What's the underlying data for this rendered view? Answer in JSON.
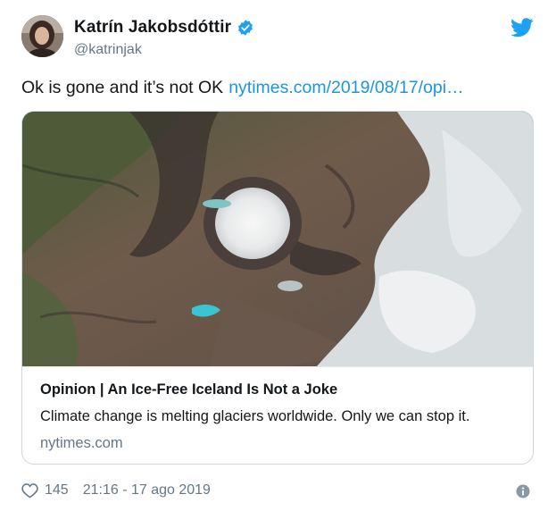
{
  "tweet": {
    "author_name": "Katrín Jakobsdóttir",
    "author_handle": "@katrinjak",
    "text": "Ok is gone and it’s not OK",
    "link_text": "nytimes.com/2019/08/17/opi…",
    "verified": true
  },
  "card": {
    "title": "Opinion | An Ice-Free Iceland Is Not a Joke",
    "description": "Climate change is melting glaciers worldwide. Only we can stop it.",
    "domain": "nytimes.com",
    "image_subject": "satellite view of Ok volcano area with glacier remnants"
  },
  "footer": {
    "like_count": "145",
    "timestamp": "21:16 - 17 ago 2019"
  },
  "icons": {
    "verified": "verified-badge-icon",
    "brand": "twitter-bird-icon",
    "like": "heart-icon",
    "info": "info-icon"
  },
  "colors": {
    "link": "#1b95e0",
    "verified": "#1da1f2",
    "muted": "#657786",
    "text": "#14171a"
  }
}
